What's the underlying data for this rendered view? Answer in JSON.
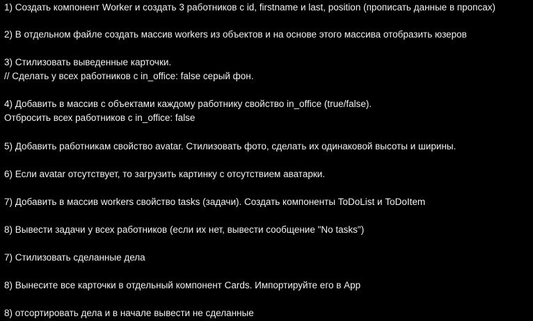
{
  "tasks": [
    {
      "lines": [
        "1) Создать компонент Worker и создать 3 работников с id, firstname и last, position (прописать данные в пропсах)"
      ]
    },
    {
      "lines": [
        "2) В отдельном файле создать массив workers из объектов и на основе этого массива отобразить юзеров"
      ]
    },
    {
      "lines": [
        "3) Стилизовать выведенные карточки.",
        "// Сделать у всех работников с in_office: false серый фон."
      ]
    },
    {
      "lines": [
        "4) Добавить в массив с объектами каждому работнику свойство in_office (true/false).",
        "Отбросить всех работников с in_office: false"
      ]
    },
    {
      "lines": [
        "5) Добавить работникам свойство avatar. Стилизовать фото, сделать их одинаковой высоты и ширины."
      ]
    },
    {
      "lines": [
        "6) Если avatar отсутствует, то загрузить картинку с отсутствием аватарки."
      ]
    },
    {
      "lines": [
        "7) Добавить в массив workers свойство tasks (задачи). Создать компоненты ToDoList и ToDoItem"
      ]
    },
    {
      "lines": [
        "8) Вывести задачи у всех работников (если их нет, вывести сообщение \"No tasks\")"
      ]
    },
    {
      "lines": [
        "7) Стилизовать сделанные дела"
      ]
    },
    {
      "lines": [
        "8) Вынесите все карточки в отдельный компонент Cards. Импортируйте его в App"
      ]
    },
    {
      "lines": [
        "8) отсортировать дела и в начале вывести не сделанные"
      ]
    }
  ]
}
